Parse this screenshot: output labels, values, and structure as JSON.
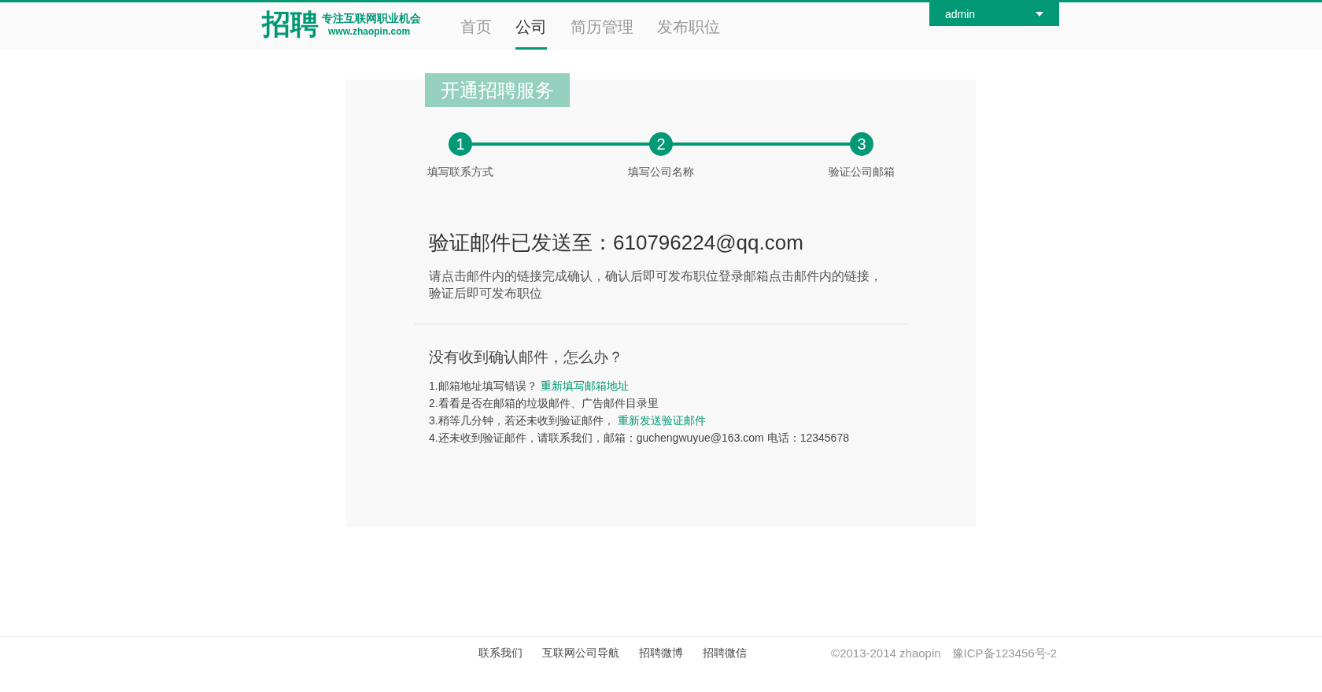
{
  "header": {
    "logo": {
      "mark": "招聘",
      "slogan": "专注互联网职业机会",
      "url": "www.zhaopin.com"
    },
    "nav": [
      {
        "label": "首页",
        "selected": false
      },
      {
        "label": "公司",
        "selected": true
      },
      {
        "label": "简历管理",
        "selected": false
      },
      {
        "label": "发布职位",
        "selected": false
      }
    ],
    "user_menu": {
      "label": "admin"
    }
  },
  "card": {
    "title": "开通招聘服务",
    "steps": [
      {
        "number": "1",
        "label": "填写联系方式",
        "done": true
      },
      {
        "number": "2",
        "label": "填写公司名称",
        "done": true
      },
      {
        "number": "3",
        "label": "验证公司邮箱",
        "done": true
      }
    ],
    "heading": "验证邮件已发送至：610796224@qq.com",
    "description": "请点击邮件内的链接完成确认，确认后即可发布职位登录邮箱点击邮件内的链接，验证后即可发布职位",
    "help_title": "没有收到确认邮件，怎么办？",
    "help_items": [
      {
        "text": "1.邮箱地址填写错误？",
        "link": "重新填写邮箱地址"
      },
      {
        "text": "2.看看是否在邮箱的垃圾邮件、广告邮件目录里"
      },
      {
        "text": "3.稍等几分钟，若还未收到验证邮件，",
        "link": "重新发送验证邮件"
      },
      {
        "text": "4.还未收到验证邮件，请联系我们，邮箱：guchengwuyue@163.com 电话：12345678"
      }
    ]
  },
  "footer": {
    "links": [
      "联系我们",
      "互联网公司导航",
      "招聘微博",
      "招聘微信"
    ],
    "copyright": "©2013-2014 zhaopin",
    "icp": "豫ICP备123456号-2"
  }
}
